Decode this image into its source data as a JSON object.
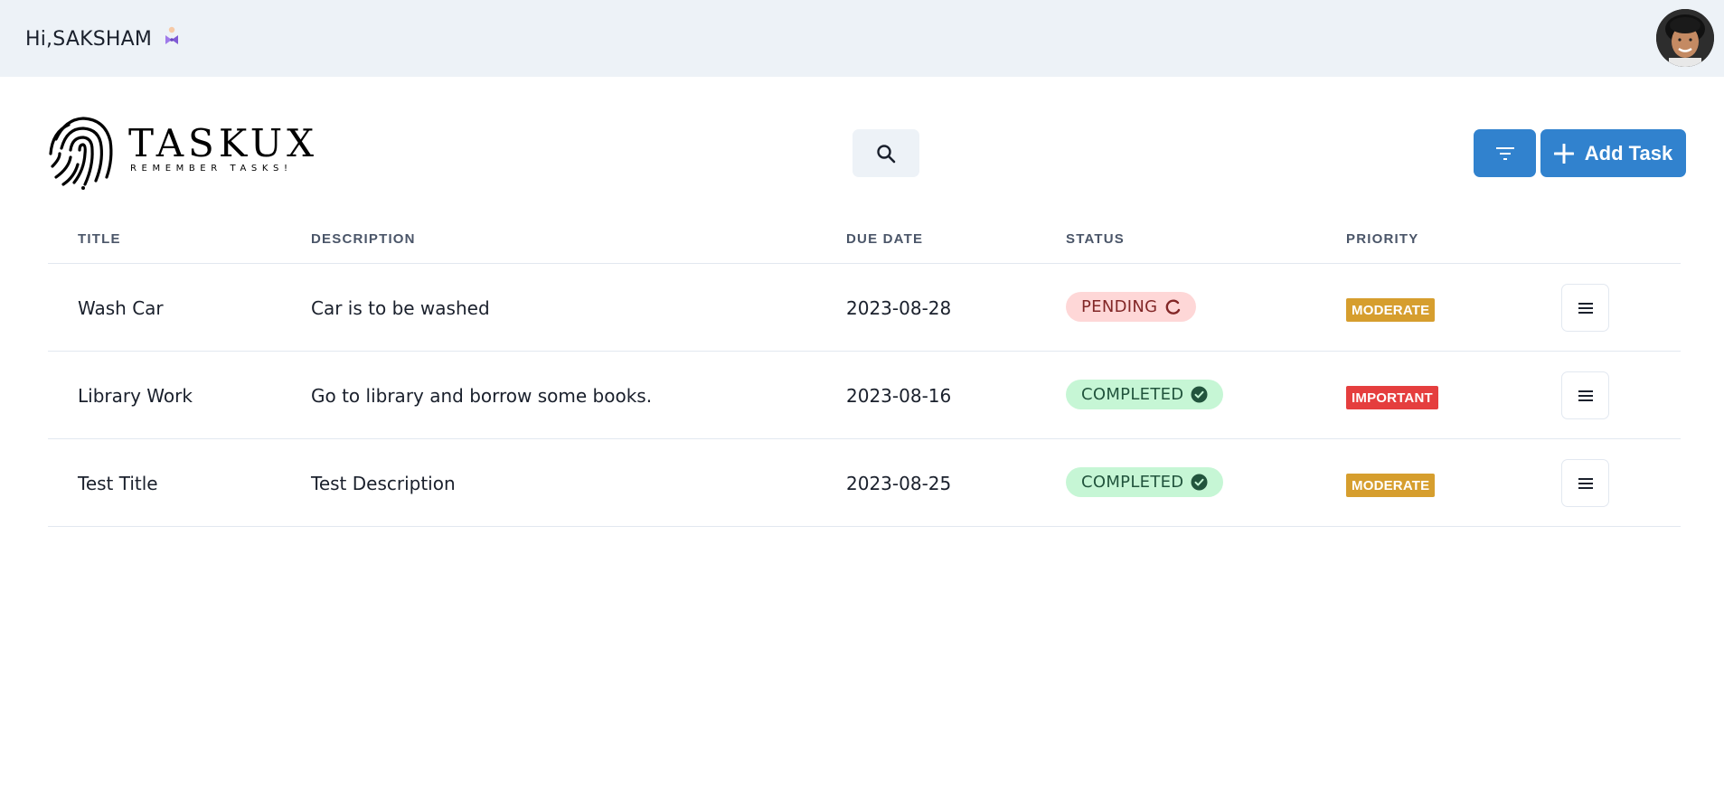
{
  "header": {
    "greeting": "Hi,SAKSHAM",
    "greeting_icon": "bow-tie-icon",
    "avatar": "user-avatar"
  },
  "brand": {
    "name": "TASKUX",
    "tagline": "REMEMBER TASKS!"
  },
  "toolbar": {
    "search_icon": "search-icon",
    "filter_icon": "filter-icon",
    "add_label": "Add Task",
    "accent": "#3182ce"
  },
  "table": {
    "columns": [
      "TITLE",
      "DESCRIPTION",
      "DUE DATE",
      "STATUS",
      "PRIORITY"
    ],
    "rows": [
      {
        "title": "Wash Car",
        "description": "Car is to be washed",
        "due": "2023-08-28",
        "status": "PENDING",
        "status_kind": "pending",
        "priority": "MODERATE",
        "priority_color": "#d69e2e"
      },
      {
        "title": "Library Work",
        "description": "Go to library and borrow some books.",
        "due": "2023-08-16",
        "status": "COMPLETED",
        "status_kind": "completed",
        "priority": "IMPORTANT",
        "priority_color": "#e53e3e"
      },
      {
        "title": "Test Title",
        "description": "Test Description",
        "due": "2023-08-25",
        "status": "COMPLETED",
        "status_kind": "completed",
        "priority": "MODERATE",
        "priority_color": "#d69e2e"
      }
    ]
  }
}
